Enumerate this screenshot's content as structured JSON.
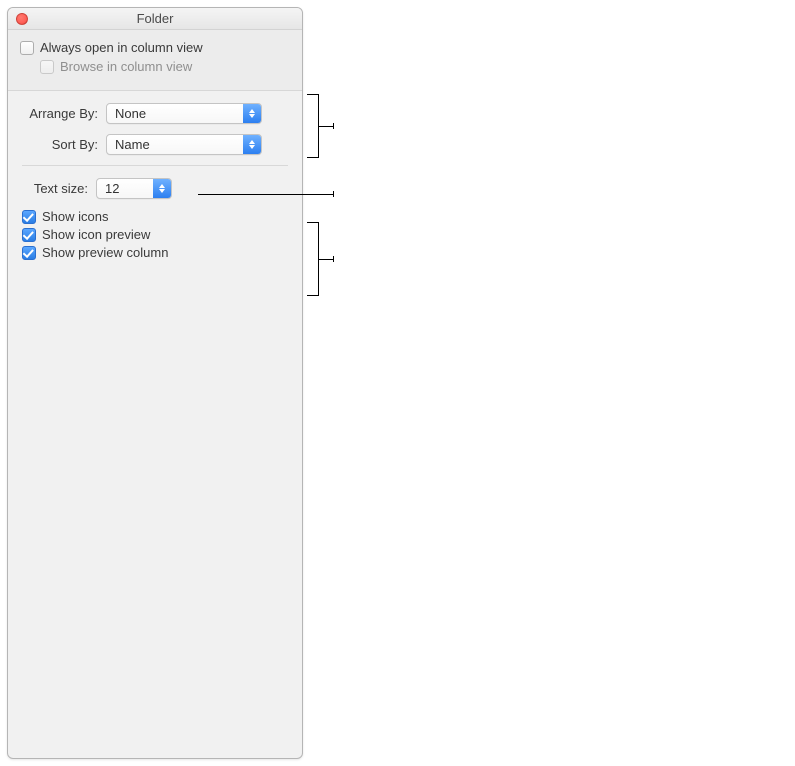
{
  "window": {
    "title": "Folder"
  },
  "top": {
    "always_open_label": "Always open in column view",
    "always_open_checked": false,
    "browse_label": "Browse in column view",
    "browse_checked": false,
    "browse_disabled": true
  },
  "arrange": {
    "label": "Arrange By:",
    "value": "None"
  },
  "sort": {
    "label": "Sort By:",
    "value": "Name"
  },
  "textsize": {
    "label": "Text size:",
    "value": "12"
  },
  "opts": {
    "show_icons": {
      "label": "Show icons",
      "checked": true
    },
    "show_icon_preview": {
      "label": "Show icon preview",
      "checked": true
    },
    "show_preview_column": {
      "label": "Show preview column",
      "checked": true
    }
  }
}
